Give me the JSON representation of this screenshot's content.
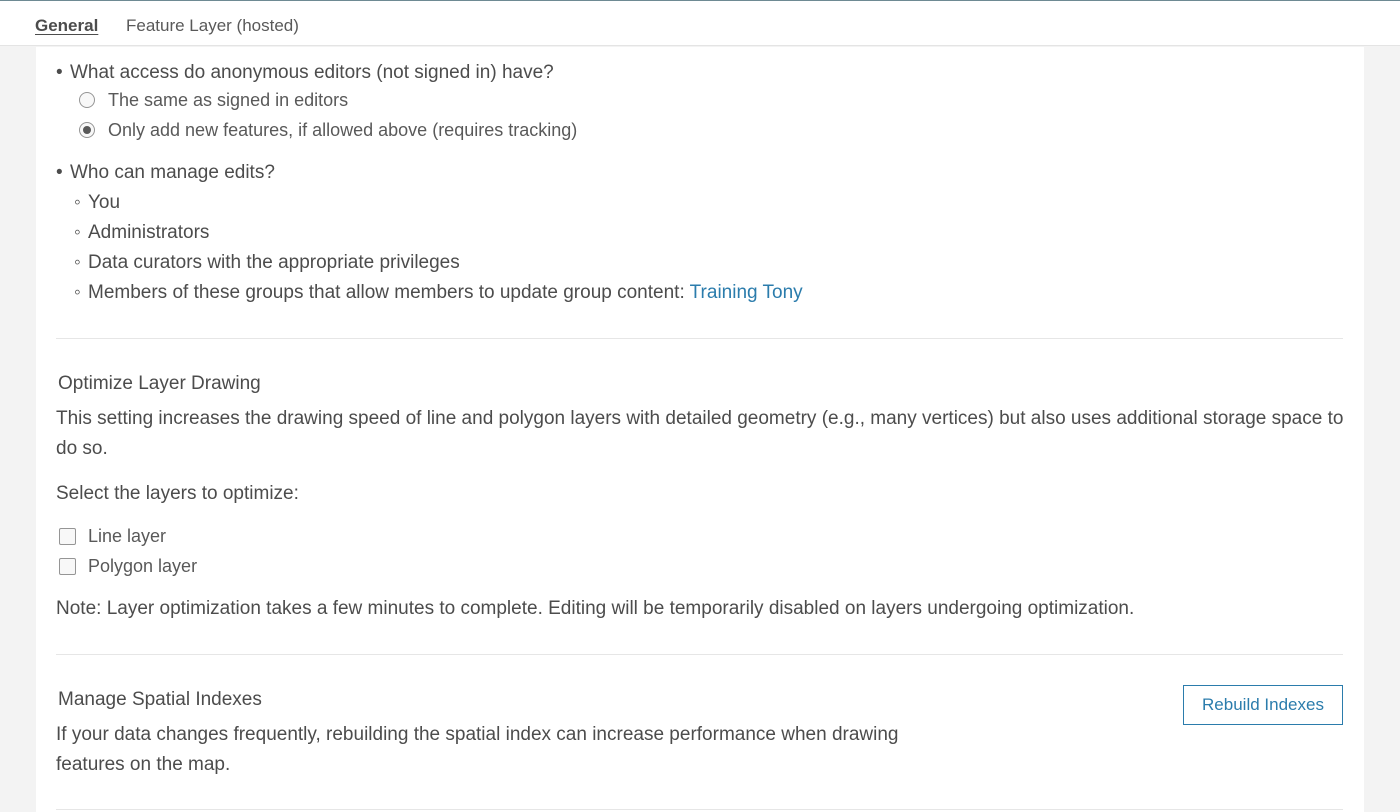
{
  "tabs": [
    {
      "label": "General",
      "active": true
    },
    {
      "label": "Feature Layer (hosted)",
      "active": false
    }
  ],
  "anonymous_access": {
    "question": "What access do anonymous editors (not signed in) have?",
    "options": [
      {
        "label": "The same as signed in editors",
        "selected": false
      },
      {
        "label": "Only add new features, if allowed above (requires tracking)",
        "selected": true
      }
    ]
  },
  "manage_edits": {
    "question": "Who can manage edits?",
    "items": [
      "You",
      "Administrators",
      "Data curators with the appropriate privileges",
      "Members of these groups that allow members to update group content: "
    ],
    "group_link": "Training Tony"
  },
  "optimize": {
    "title": "Optimize Layer Drawing",
    "description": "This setting increases the drawing speed of line and polygon layers with detailed geometry (e.g., many vertices) but also uses additional storage space to do so.",
    "select_label": "Select the layers to optimize:",
    "layers": [
      {
        "label": "Line layer",
        "checked": false
      },
      {
        "label": "Polygon layer",
        "checked": false
      }
    ],
    "note": "Note: Layer optimization takes a few minutes to complete. Editing will be temporarily disabled on layers undergoing optimization."
  },
  "spatial_indexes": {
    "title": "Manage Spatial Indexes",
    "description": "If your data changes frequently, rebuilding the spatial index can increase performance when drawing features on the map.",
    "button_label": "Rebuild Indexes"
  },
  "glyphs": {
    "bullet": "•",
    "sub_bullet": "◦"
  }
}
